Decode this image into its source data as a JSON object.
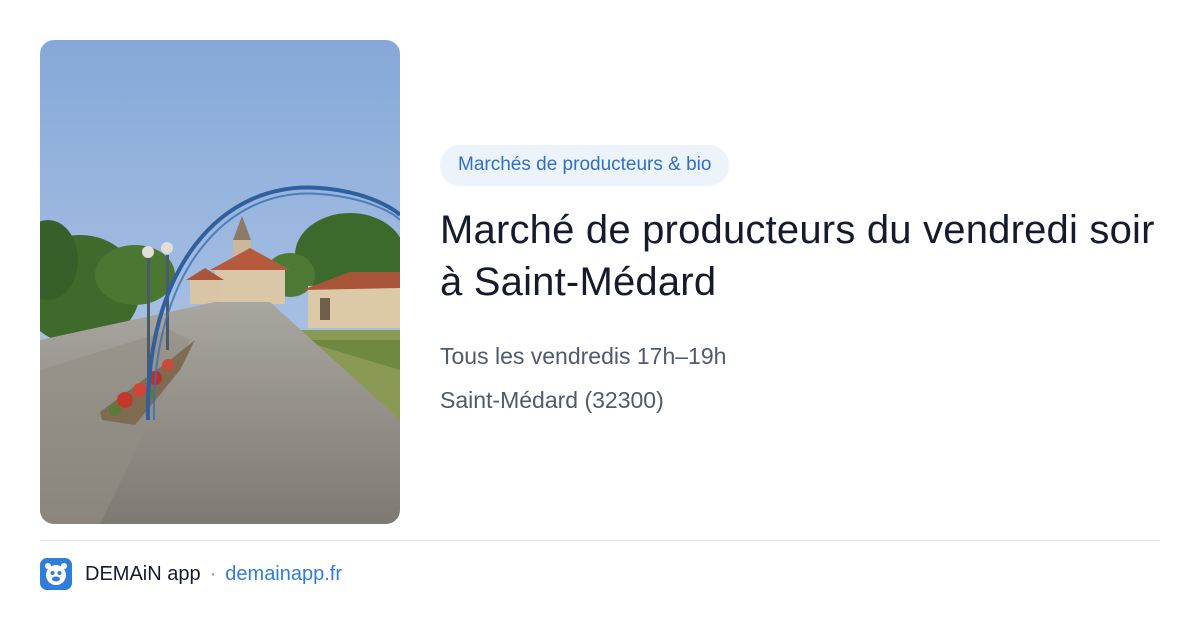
{
  "card": {
    "category": "Marchés de producteurs & bio",
    "title": "Marché de producteurs du vendredi soir à Saint-Médard",
    "schedule": "Tous les vendredis 17h–19h",
    "location": "Saint-Médard (32300)"
  },
  "footer": {
    "brand": "DEMAiN app",
    "separator": "·",
    "domain": "demainapp.fr",
    "icon": "demain-app-logo-icon"
  },
  "colors": {
    "accent": "#2f7ed8",
    "tag_bg": "#edf3fb",
    "title": "#151a2d",
    "meta": "#505a6c"
  }
}
